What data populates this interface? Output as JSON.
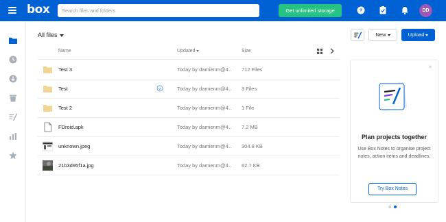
{
  "topbar": {
    "logo": "box",
    "search_placeholder": "Search files and folders",
    "cta_label": "Get unlimited storage",
    "avatar_initials": "DD",
    "icons": [
      "help-icon",
      "tasks-icon",
      "notifications-icon"
    ]
  },
  "rail": {
    "items": [
      "all-files-icon",
      "recents-icon",
      "synced-icon",
      "trash-icon",
      "notes-icon",
      "relay-icon",
      "favorites-icon"
    ]
  },
  "header": {
    "title": "All files",
    "new_label": "New",
    "upload_label": "Upload"
  },
  "table": {
    "columns": {
      "name": "Name",
      "updated": "Updated",
      "size": "Size"
    },
    "rows": [
      {
        "type": "folder",
        "name": "Test 3",
        "updated": "Today by damienm@4…",
        "size": "712 Files",
        "shared": false
      },
      {
        "type": "folder",
        "name": "Test",
        "updated": "Today by damienm@4…",
        "size": "3 Files",
        "shared": true
      },
      {
        "type": "folder",
        "name": "Test 2",
        "updated": "Today by damienm@4…",
        "size": "1 File",
        "shared": false
      },
      {
        "type": "file",
        "name": "FDroid.apk",
        "updated": "Today by damienm@4…",
        "size": "7.2 MB",
        "shared": false
      },
      {
        "type": "image",
        "name": "unknown.jpeg",
        "updated": "Today by damienm@4…",
        "size": "304.8 KB",
        "shared": false
      },
      {
        "type": "image",
        "name": "21b3d95f1a.jpg",
        "updated": "Today by damienm@4…",
        "size": "62.7 KB",
        "shared": false
      }
    ]
  },
  "panel": {
    "title": "Plan projects together",
    "description": "Use Box Notes to organise project notes, action items and deadlines.",
    "button_label": "Try Box Notes"
  },
  "colors": {
    "brand": "#0061d5",
    "cta": "#26c281",
    "avatar": "#9b59b6",
    "folder": "#f1d592"
  }
}
